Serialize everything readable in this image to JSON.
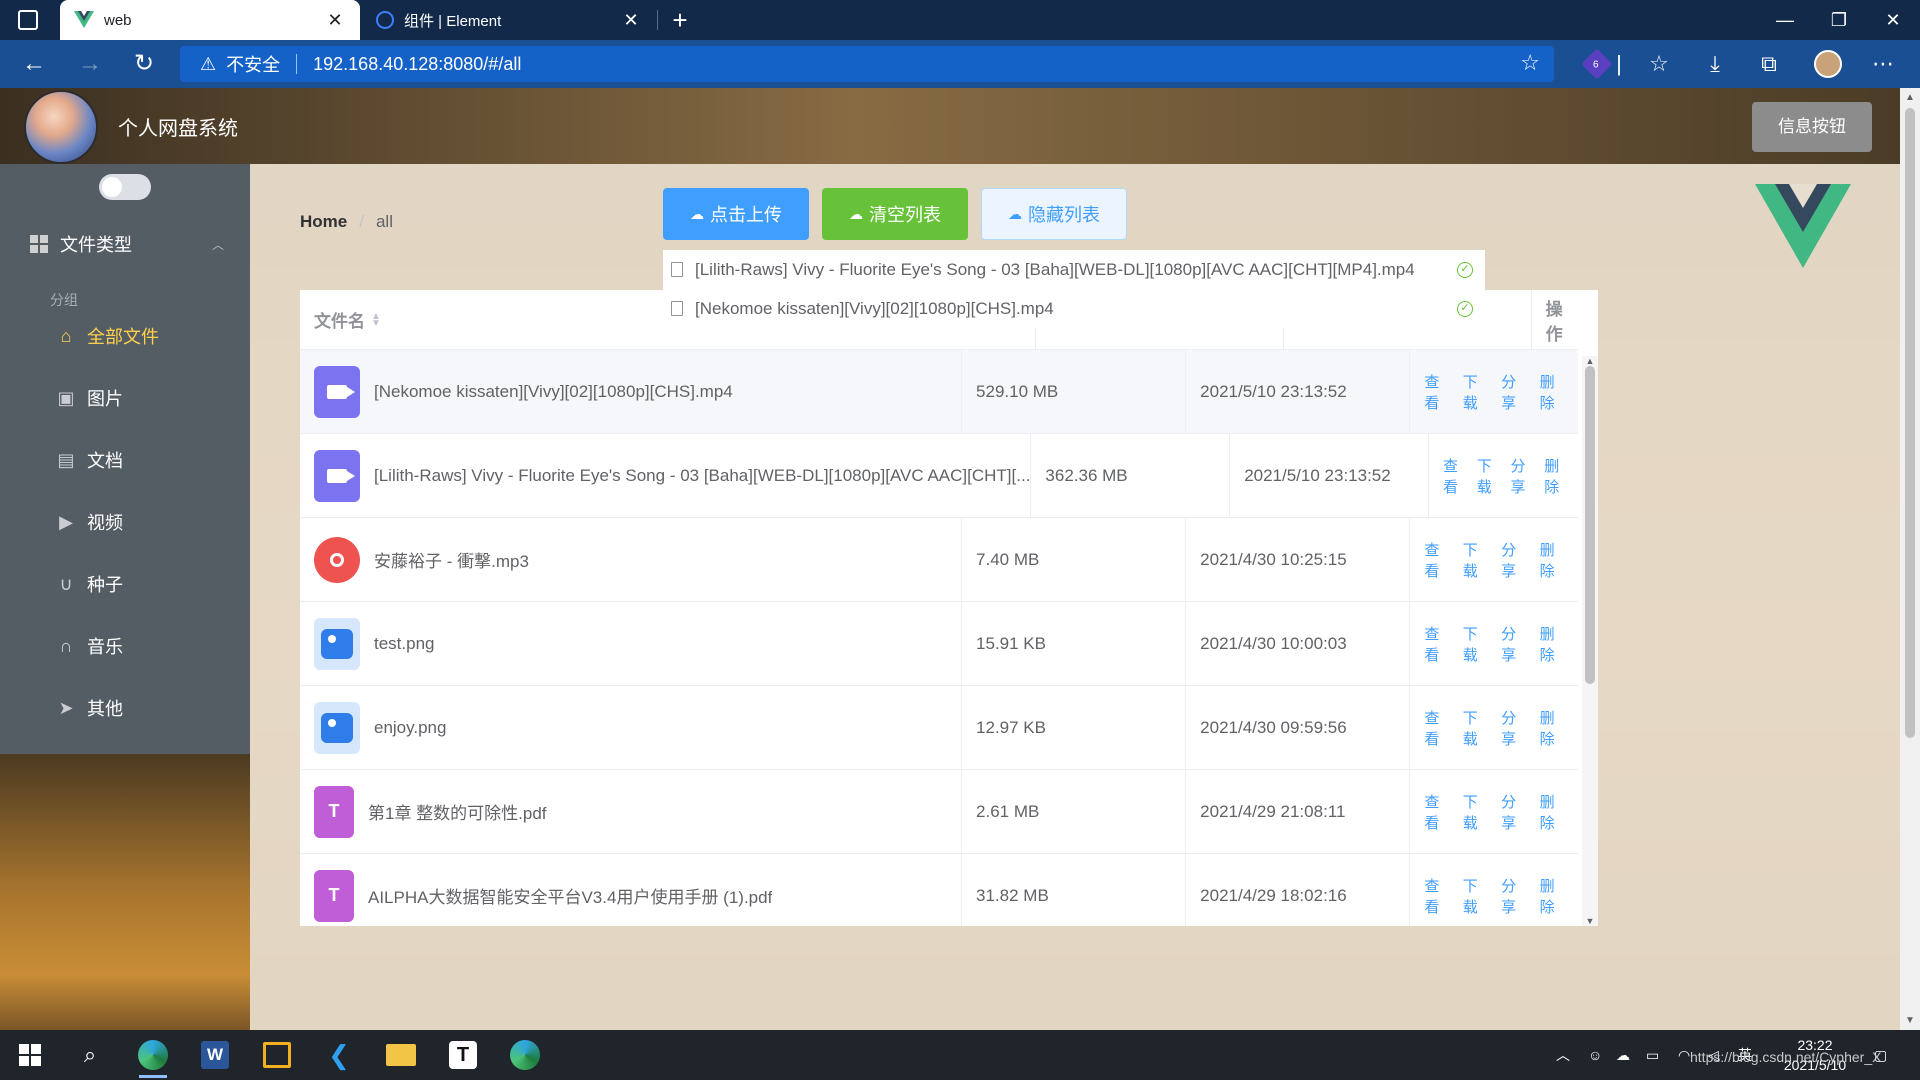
{
  "browser": {
    "tabs": [
      {
        "title": "web",
        "active": true
      },
      {
        "title": "组件 | Element",
        "active": false
      }
    ],
    "security_label": "不安全",
    "url": "192.168.40.128:8080/#/all",
    "extension_badge": "6"
  },
  "header": {
    "title": "个人网盘系统",
    "info_button": "信息按钮"
  },
  "sidebar": {
    "section_title": "文件类型",
    "group_label": "分组",
    "items": [
      {
        "label": "全部文件",
        "icon": "home-icon",
        "active": true
      },
      {
        "label": "图片",
        "icon": "picture-icon",
        "active": false
      },
      {
        "label": "文档",
        "icon": "document-icon",
        "active": false
      },
      {
        "label": "视频",
        "icon": "video-camera-icon",
        "active": false
      },
      {
        "label": "种子",
        "icon": "magnet-icon",
        "active": false
      },
      {
        "label": "音乐",
        "icon": "headset-icon",
        "active": false
      },
      {
        "label": "其他",
        "icon": "paper-plane-icon",
        "active": false
      }
    ]
  },
  "breadcrumb": {
    "home": "Home",
    "current": "all"
  },
  "toolbar": {
    "upload": "点击上传",
    "clear": "清空列表",
    "hide": "隐藏列表"
  },
  "upload_list": [
    "[Lilith-Raws] Vivy - Fluorite Eye's Song - 03 [Baha][WEB-DL][1080p][AVC AAC][CHT][MP4].mp4",
    "[Nekomoe kissaten][Vivy][02][1080p][CHS].mp4"
  ],
  "table": {
    "columns": {
      "name": "文件名",
      "ops": "操作"
    },
    "actions": {
      "view": "查看",
      "download": "下载",
      "share": "分享",
      "delete": "删除"
    },
    "rows": [
      {
        "name": "[Nekomoe kissaten][Vivy][02][1080p][CHS].mp4",
        "size": "529.10 MB",
        "date": "2021/5/10 23:13:52",
        "type": "video"
      },
      {
        "name": "[Lilith-Raws] Vivy - Fluorite Eye's Song - 03 [Baha][WEB-DL][1080p][AVC AAC][CHT][...",
        "size": "362.36 MB",
        "date": "2021/5/10 23:13:52",
        "type": "video"
      },
      {
        "name": "安藤裕子 - 衝撃.mp3",
        "size": "7.40 MB",
        "date": "2021/4/30 10:25:15",
        "type": "music"
      },
      {
        "name": "test.png",
        "size": "15.91 KB",
        "date": "2021/4/30 10:00:03",
        "type": "image"
      },
      {
        "name": "enjoy.png",
        "size": "12.97 KB",
        "date": "2021/4/30 09:59:56",
        "type": "image"
      },
      {
        "name": "第1章 整数的可除性.pdf",
        "size": "2.61 MB",
        "date": "2021/4/29 21:08:11",
        "type": "pdf"
      },
      {
        "name": "AILPHA大数据智能安全平台V3.4用户使用手册 (1).pdf",
        "size": "31.82 MB",
        "date": "2021/4/29 18:02:16",
        "type": "pdf"
      }
    ]
  },
  "taskbar": {
    "clock_time": "23:22",
    "clock_date": "2021/5/10",
    "ime": "英",
    "watermark": "https://blog.csdn.net/Cypher_X"
  },
  "colors": {
    "primary": "#409eff",
    "success": "#67c23a",
    "sidebar_bg": "#545c64",
    "active_menu": "#ffd04b",
    "vue_green": "#41b883",
    "vue_dark": "#35495e"
  }
}
